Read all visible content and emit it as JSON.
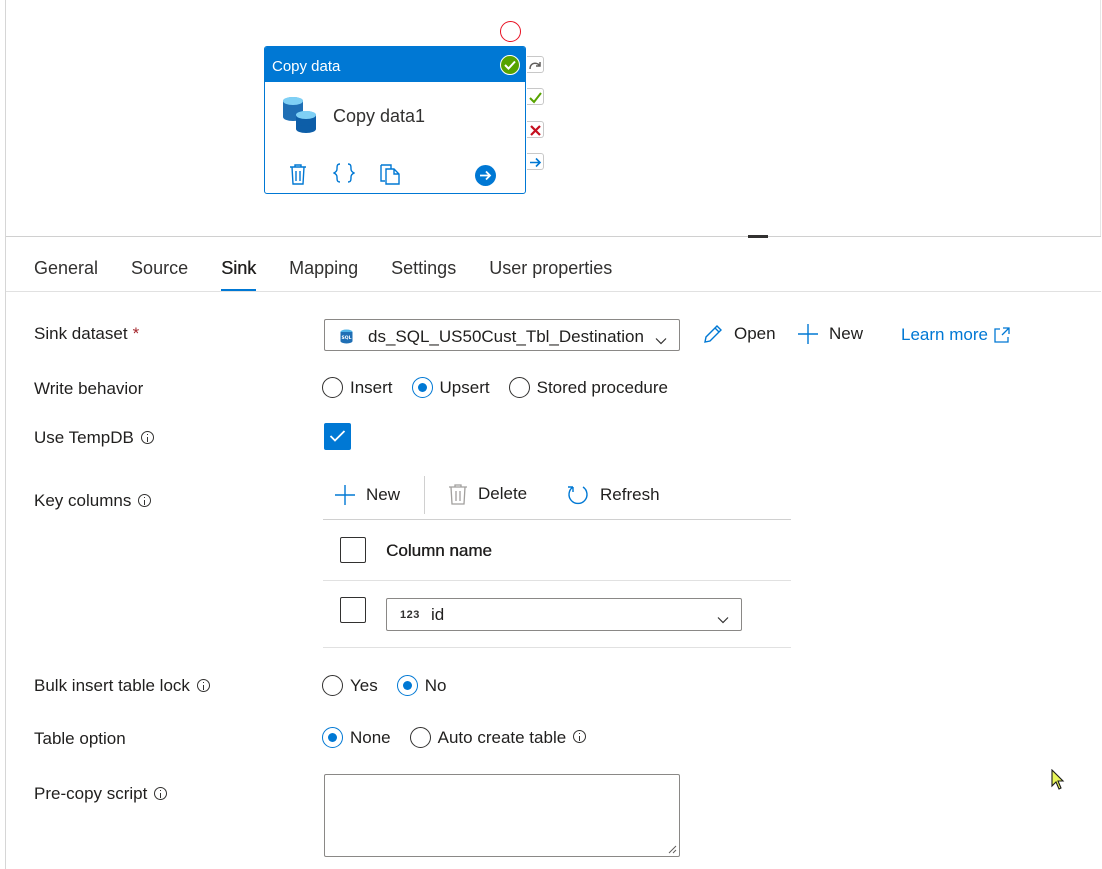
{
  "canvas": {
    "activity": {
      "header_title": "Copy data",
      "name": "Copy data1",
      "icons": [
        "database-icon",
        "delete-icon",
        "code-braces-icon",
        "copy-icon",
        "arrow-right-icon"
      ],
      "status_icon": "check-circle-icon",
      "ports": [
        "redo-arrow-icon",
        "success-check-icon",
        "failure-x-icon",
        "completion-arrow-icon"
      ]
    }
  },
  "tabs": [
    {
      "label": "General"
    },
    {
      "label": "Source"
    },
    {
      "label": "Sink",
      "active": true
    },
    {
      "label": "Mapping"
    },
    {
      "label": "Settings"
    },
    {
      "label": "User properties"
    }
  ],
  "sink": {
    "dataset": {
      "label": "Sink dataset",
      "required_mark": "*",
      "icon": "sql-icon",
      "value": "ds_SQL_US50Cust_Tbl_Destination",
      "open_label": "Open",
      "new_label": "New",
      "learn_more": "Learn more"
    },
    "write_behavior": {
      "label": "Write behavior",
      "options": [
        "Insert",
        "Upsert",
        "Stored procedure"
      ],
      "selected": "Upsert"
    },
    "use_tempdb": {
      "label": "Use TempDB",
      "checked": true
    },
    "key_columns": {
      "label": "Key columns",
      "new_label": "New",
      "delete_label": "Delete",
      "refresh_label": "Refresh",
      "column_header": "Column name",
      "rows": [
        {
          "type_badge": "123",
          "value": "id"
        }
      ]
    },
    "bulk_insert_lock": {
      "label": "Bulk insert table lock",
      "options": [
        "Yes",
        "No"
      ],
      "selected": "No"
    },
    "table_option": {
      "label": "Table option",
      "options": [
        "None",
        "Auto create table"
      ],
      "selected": "None"
    },
    "pre_copy_script": {
      "label": "Pre-copy script",
      "value": ""
    }
  },
  "colors": {
    "accent": "#0078d4",
    "success": "#57a300",
    "error": "#c50f1f",
    "required": "#a4262c"
  }
}
